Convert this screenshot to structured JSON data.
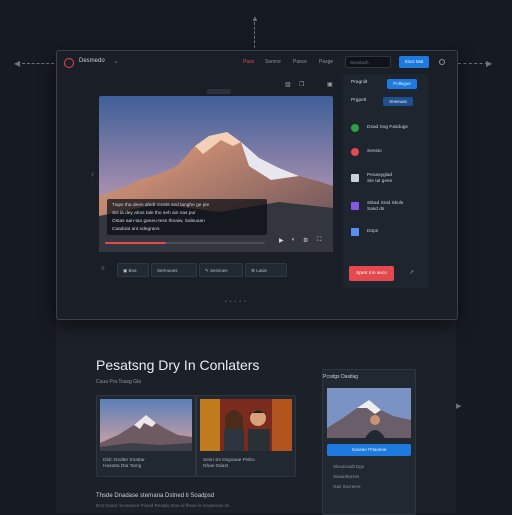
{
  "app": {
    "title": "Desmedo"
  },
  "topbar": {
    "nav": [
      "Pass",
      "Senrce",
      "Pasce",
      "Pasge"
    ],
    "search_placeholder": "Sesnlach",
    "primary_button": "Sloct Mat"
  },
  "video": {
    "caption_lines": [
      "Tiaps tha deen ahidt reosts zed tanghe ge pie",
      "Sis ia dey ahos tale tho seh ain nas pur",
      "Ostas aan-tao ganeu-tess thnaiw, Salsuuan",
      "Caadoat ant ndegrans"
    ],
    "progress": 0.38
  },
  "toolbar": [
    "Boa",
    "Sermuoes",
    "Sesnoes",
    "Lasie"
  ],
  "side_panel": {
    "pill_1": "Pragnilt",
    "pill_2": "Pollegue",
    "pill_3": "Prgpelt",
    "pill_4": "Sneeuas",
    "items": [
      {
        "label": "Dsad Sog Fasdugs",
        "icon": "green-dot-icon",
        "color": "#2ea043"
      },
      {
        "label": "Sensio",
        "icon": "red-dot-icon",
        "color": "#e5484d"
      },
      {
        "label": "Peoasyglad\nSie tal gees",
        "icon": "play-square-icon",
        "color": "#c9d1d9"
      },
      {
        "label": "Stkad Snid Skols\nSasd ds",
        "icon": "image-icon",
        "color": "#8957e5"
      },
      {
        "label": "Dops",
        "icon": "gallery-icon",
        "color": "#5b8def"
      }
    ],
    "cta": "Spetr Inn seco"
  },
  "lower": {
    "heading": "Pesatsng Dry In Conlaters",
    "subhead": "Cuua Pra Toasg Gla",
    "cards": [
      {
        "label": "Dldc Dedtte Snattar\nHasatta Dta Tamg"
      },
      {
        "label": "Sesn Ss Dsgoaae Pisbo\nNhas Ddast"
      }
    ],
    "right_card": {
      "title": "Pcodgs Dastlag",
      "button": "Sosean Prtaonne",
      "lines": [
        "Slunaroadt Dgs",
        "Ssaurelarzes",
        "Gas Socreers"
      ]
    },
    "footer_title": "Thsde Dnadase sternana Dstned ti Soadpsd",
    "footer_sub": "Dos Doasc Scseanen Pnsed Reotda Stan-al fheas ls rnsyseoan ns"
  }
}
